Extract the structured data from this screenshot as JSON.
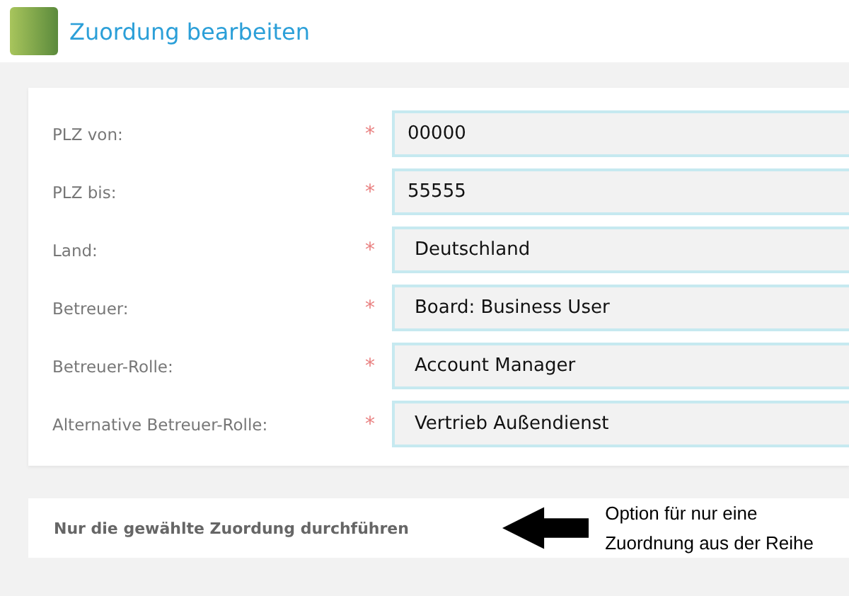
{
  "header": {
    "title": "Zuordung bearbeiten"
  },
  "fields": [
    {
      "label": "PLZ von:",
      "required_mark": "*",
      "value": "00000",
      "kind": "input"
    },
    {
      "label": "PLZ bis:",
      "required_mark": "*",
      "value": "55555",
      "kind": "input"
    },
    {
      "label": "Land:",
      "required_mark": "*",
      "value": "Deutschland",
      "kind": "select"
    },
    {
      "label": "Betreuer:",
      "required_mark": "*",
      "value": "Board: Business User",
      "kind": "select"
    },
    {
      "label": "Betreuer-Rolle:",
      "required_mark": "*",
      "value": "Account Manager",
      "kind": "select"
    },
    {
      "label": "Alternative Betreuer-Rolle:",
      "required_mark": "*",
      "value": "Vertrieb Außendienst",
      "kind": "select"
    }
  ],
  "option": {
    "label": "Nur die gewählte Zuordung durchführen"
  },
  "annotation": {
    "text": "Option für nur eine Zuordnung aus der Reihe"
  }
}
